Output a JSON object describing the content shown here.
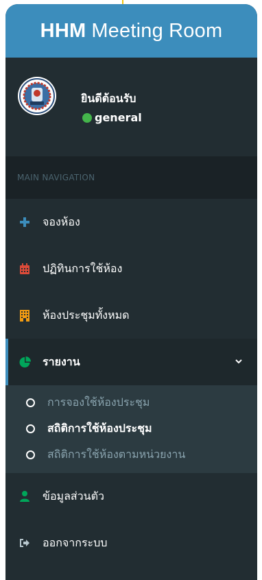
{
  "header": {
    "brand_bold": "HHM",
    "brand_rest": "Meeting Room"
  },
  "user": {
    "welcome": "ยินดีต้อนรับ",
    "status": "general",
    "status_color": "#44b54b"
  },
  "nav": {
    "header": "MAIN NAVIGATION",
    "items": [
      {
        "label": "จองห้อง",
        "icon": "plus-icon",
        "color": "#3c8dbc"
      },
      {
        "label": "ปฏิทินการใช้ห้อง",
        "icon": "calendar-icon",
        "color": "#dd4b39"
      },
      {
        "label": "ห้องประชุมทั้งหมด",
        "icon": "building-icon",
        "color": "#f39c12"
      },
      {
        "label": "รายงาน",
        "icon": "pie-chart-icon",
        "color": "#00a65a",
        "active": true
      },
      {
        "label": "ข้อมูลส่วนตัว",
        "icon": "user-icon",
        "color": "#00a65a"
      },
      {
        "label": "ออกจากระบบ",
        "icon": "sign-out-icon",
        "color": "#b8c7ce"
      }
    ],
    "report_sub": [
      {
        "label": "การจองใช้ห้องประชุม"
      },
      {
        "label": "สถิติการใช้ห้องประชุม",
        "current": true
      },
      {
        "label": "สถิติการใช้ห้องตามหน่วยงาน"
      }
    ]
  }
}
